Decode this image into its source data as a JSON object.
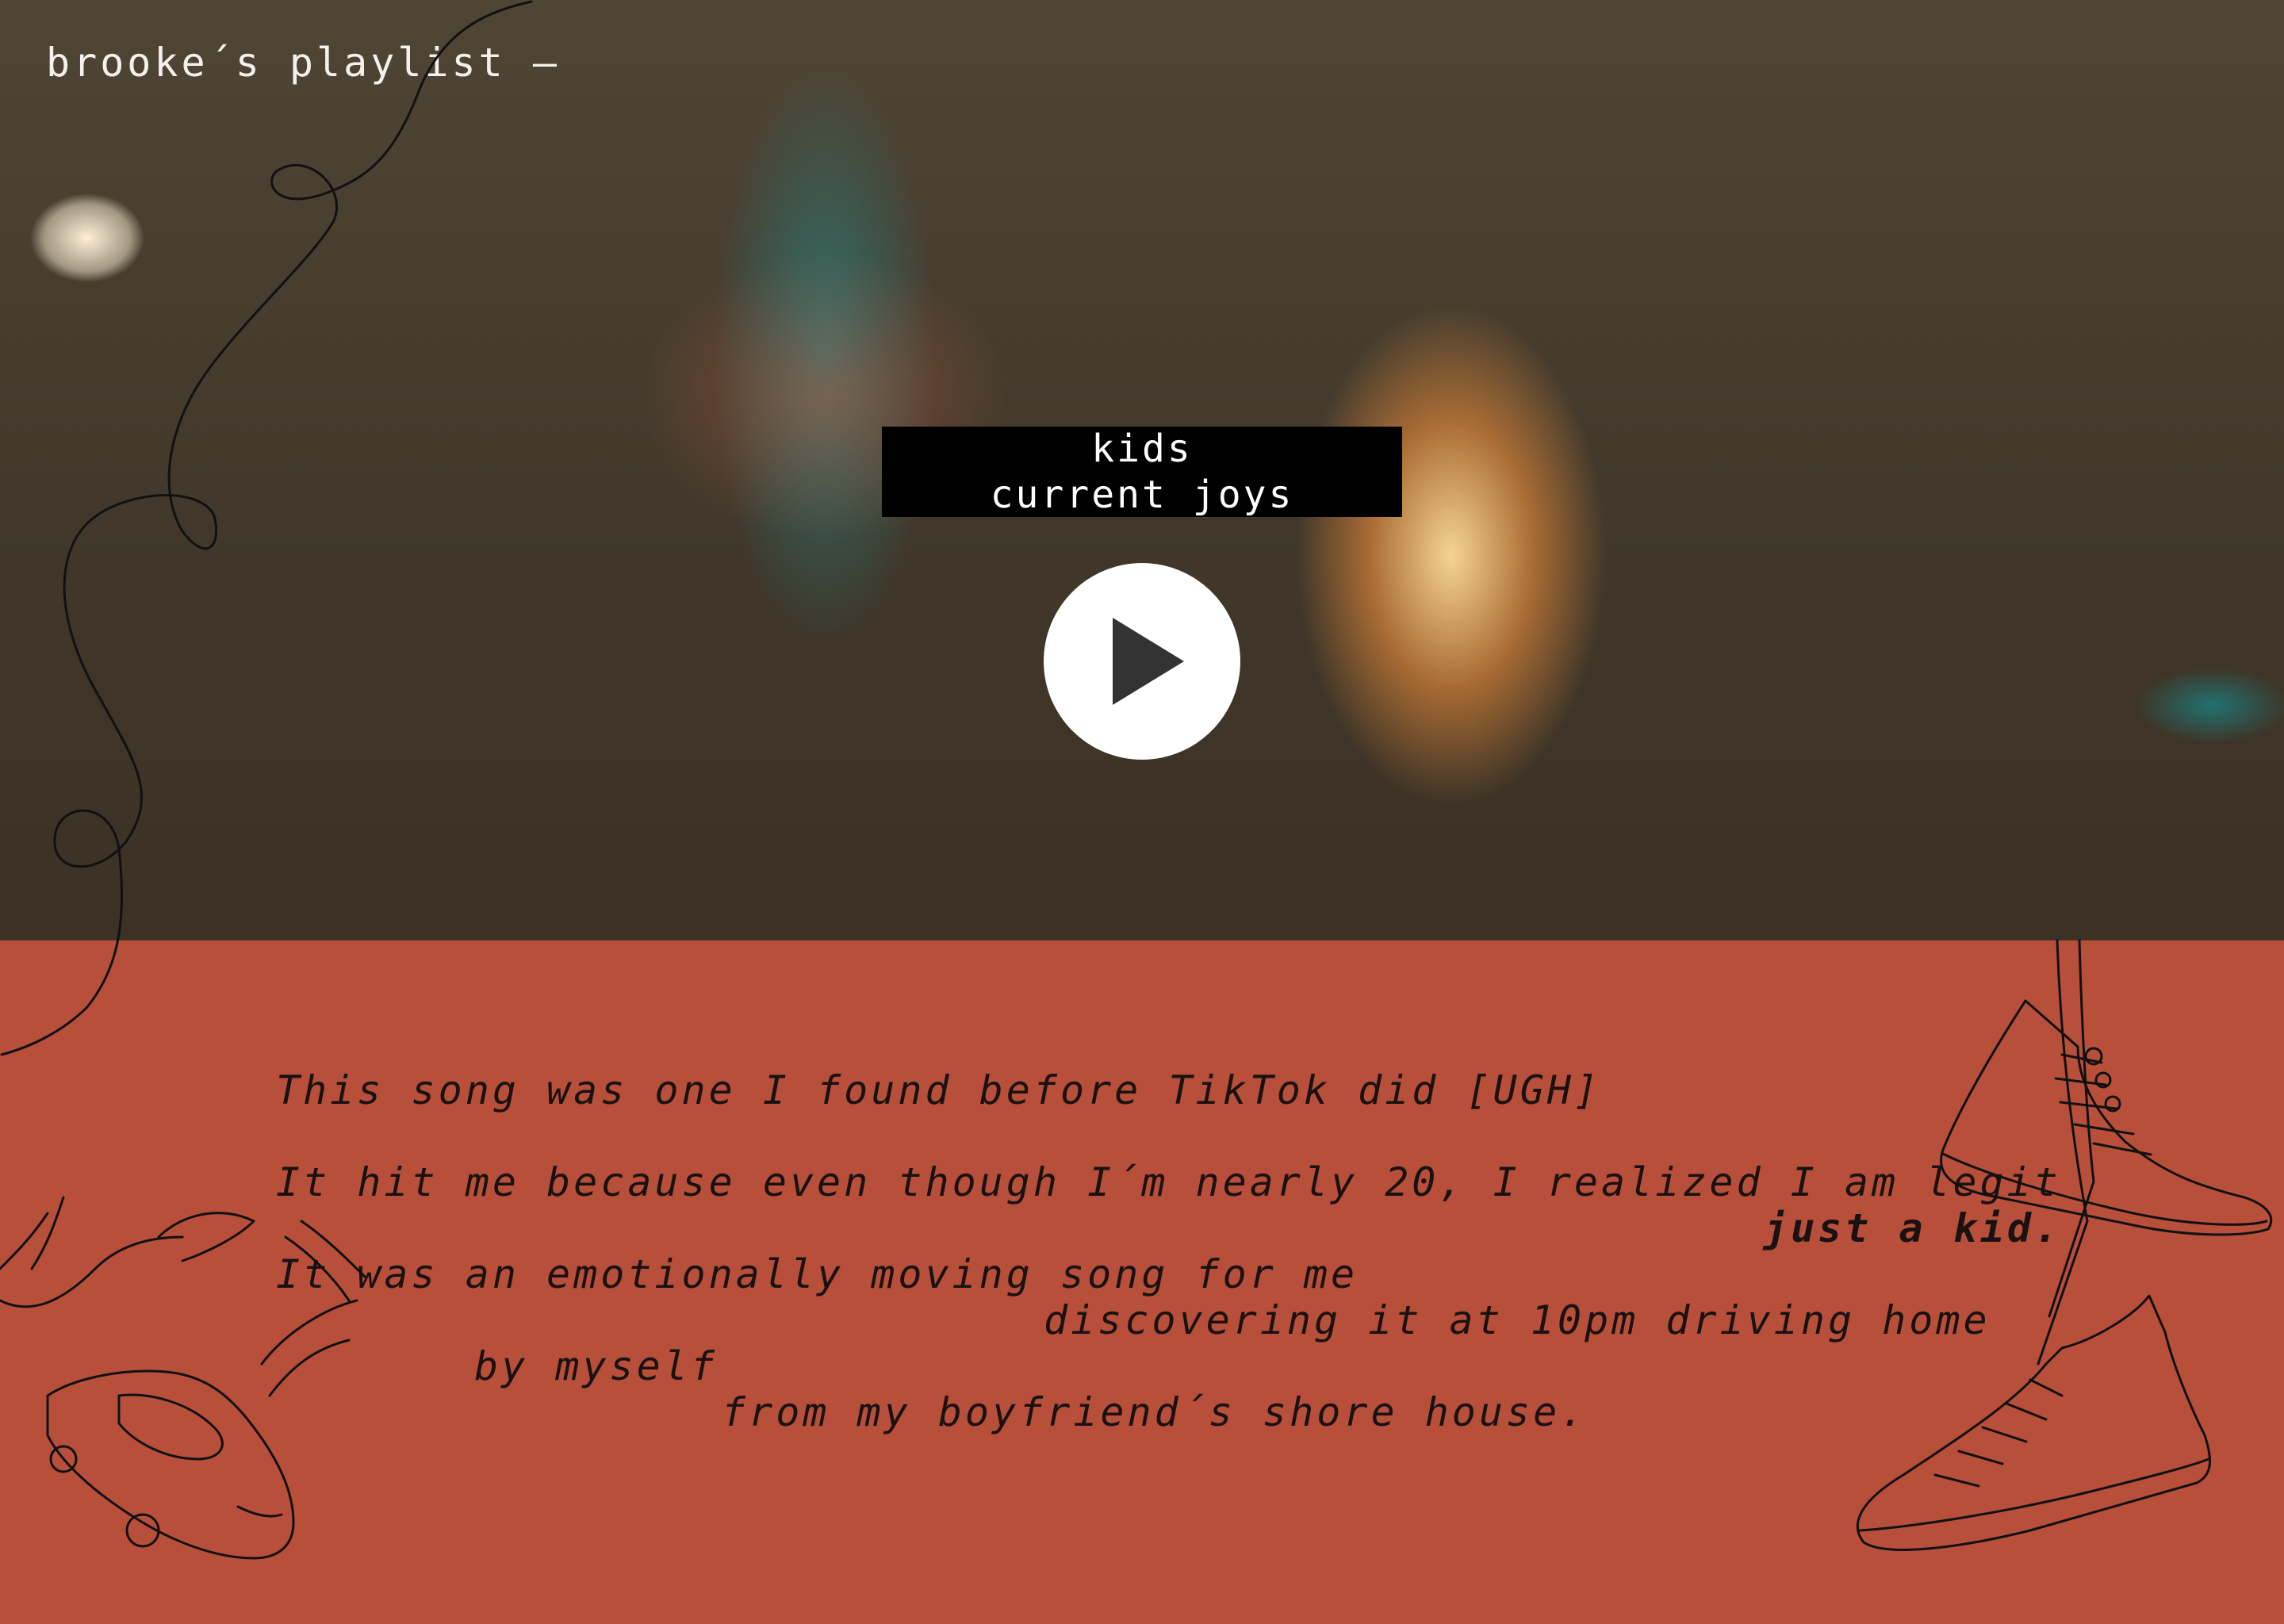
{
  "header": {
    "title": "brooke´s playlist —"
  },
  "track": {
    "title": "kids",
    "artist": "current joys"
  },
  "player": {
    "state": "paused",
    "play_icon": "play-icon"
  },
  "note": {
    "lines": [
      "This song was one I found before TikTok did [UGH]",
      "It hit me because even though I´m nearly 20, I realized I am legit",
      "just a kid.",
      "It was an emotionally moving song for me",
      "discovering it at 10pm driving home",
      "by myself",
      "from my boyfriend´s shore house."
    ]
  },
  "colors": {
    "note_background": "#b84f3b",
    "card_background": "#000000",
    "accent_white": "#ffffff"
  }
}
